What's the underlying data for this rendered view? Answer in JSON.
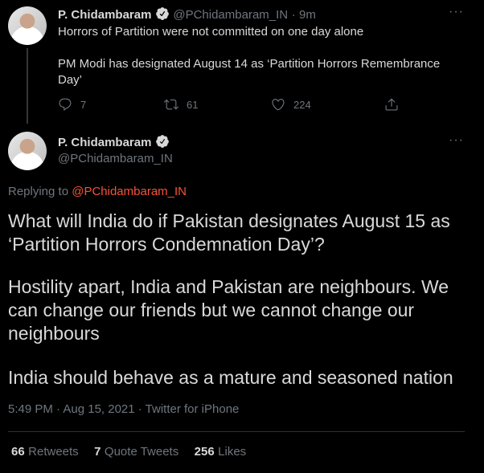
{
  "parent_tweet": {
    "author_name": "P. Chidambaram",
    "handle": "@PChidambaram_IN",
    "separator": "·",
    "time": "9m",
    "line1": "Horrors of Partition were not committed on one day alone",
    "line2": "PM Modi has designated August 14 as ‘Partition Horrors Remembrance",
    "line3": "Day’",
    "replies": "7",
    "retweets": "61",
    "likes": "224"
  },
  "main_tweet": {
    "author_name": "P. Chidambaram",
    "handle": "@PChidambaram_IN",
    "replying_prefix": "Replying to",
    "replying_to": "@PChidambaram_IN",
    "p1_line1": "What will India do if Pakistan designates August 15 as",
    "p1_line2": "‘Partition Horrors Condemnation Day’?",
    "p2_line1": "Hostility apart, India and Pakistan are neighbours. We",
    "p2_line2": "can change our friends but we cannot change our",
    "p2_line3": "neighbours",
    "p3_line1": "India should behave as a mature and seasoned nation",
    "timestamp": "5:49 PM · Aug 15, 2021 · Twitter for iPhone"
  },
  "stats": {
    "retweets_count": "66",
    "retweets_label": "Retweets",
    "quotes_count": "7",
    "quotes_label": "Quote Tweets",
    "likes_count": "256",
    "likes_label": "Likes"
  },
  "more_label": "···",
  "colors": {
    "background": "#000000",
    "text": "#d9d9d9",
    "muted": "#6e767d",
    "link": "#f4533a",
    "verified": "#d9d9d9"
  },
  "icons": [
    "avatar",
    "verified-badge-icon",
    "more-icon",
    "reply-icon",
    "retweet-icon",
    "like-icon",
    "share-icon"
  ]
}
